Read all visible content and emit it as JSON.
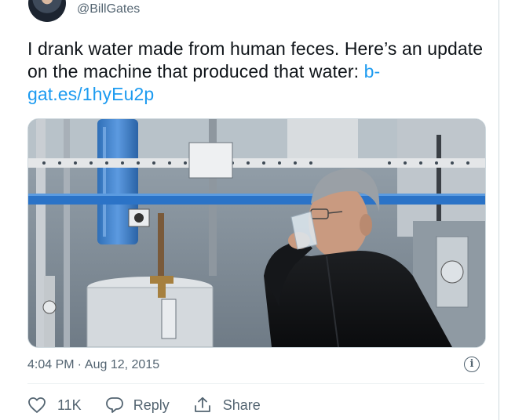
{
  "tweet": {
    "handle": "@BillGates",
    "text_main": "I drank water made from human feces. Here’s an update on the machine that produced that water: ",
    "text_link": "b-gat.es/1hyEu2p",
    "timestamp_time": "4:04 PM",
    "timestamp_sep": "·",
    "timestamp_date": "Aug 12, 2015"
  },
  "actions": {
    "like_count": "11K",
    "reply_label": "Reply",
    "share_label": "Share"
  },
  "icons": {
    "info": "info-icon",
    "like": "heart-icon",
    "reply": "speech-bubble-icon",
    "share": "share-upload-icon"
  },
  "colors": {
    "link": "#1d9bf0",
    "secondary_text": "#536471",
    "primary_text": "#0f1419"
  }
}
